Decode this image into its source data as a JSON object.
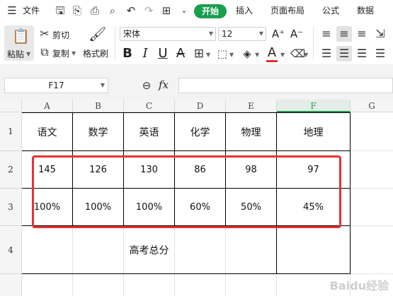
{
  "menubar": {
    "hamburger_icon": "menu-icon",
    "file_label": "文件",
    "quick_icons": [
      "save-icon",
      "export-icon",
      "print-icon",
      "print-preview-icon",
      "undo-icon",
      "redo-icon",
      "table-icon",
      "more-chevron-icon"
    ],
    "tabs": [
      "开始",
      "插入",
      "页面布局",
      "公式",
      "数据"
    ]
  },
  "ribbon": {
    "paste_label": "粘贴",
    "cut_label": "剪切",
    "copy_label": "复制",
    "format_painter_label": "格式刷",
    "font_name": "宋体",
    "font_size": "12",
    "grow_font": "A⁺",
    "shrink_font": "A⁻",
    "bold": "B",
    "italic": "I",
    "underline": "U",
    "strike": "A",
    "font_color": "A",
    "font_color_hex": "#e53333"
  },
  "formula_bar": {
    "cell_reference": "F17",
    "fx_label": "fx",
    "value": ""
  },
  "sheet": {
    "columns": [
      "A",
      "B",
      "C",
      "D",
      "E",
      "F",
      "G"
    ],
    "selected_column": "F",
    "rows": [
      "1",
      "2",
      "3",
      "4"
    ],
    "headers": [
      "语文",
      "数学",
      "英语",
      "化学",
      "物理",
      "地理"
    ],
    "scores": [
      "145",
      "126",
      "130",
      "86",
      "98",
      "97"
    ],
    "percents": [
      "100%",
      "100%",
      "100%",
      "60%",
      "50%",
      "45%"
    ],
    "total_label": "高考总分"
  },
  "watermark": "Baidu经验",
  "colors": {
    "accent": "#1a9f4d",
    "highlight_box": "#e53333"
  }
}
